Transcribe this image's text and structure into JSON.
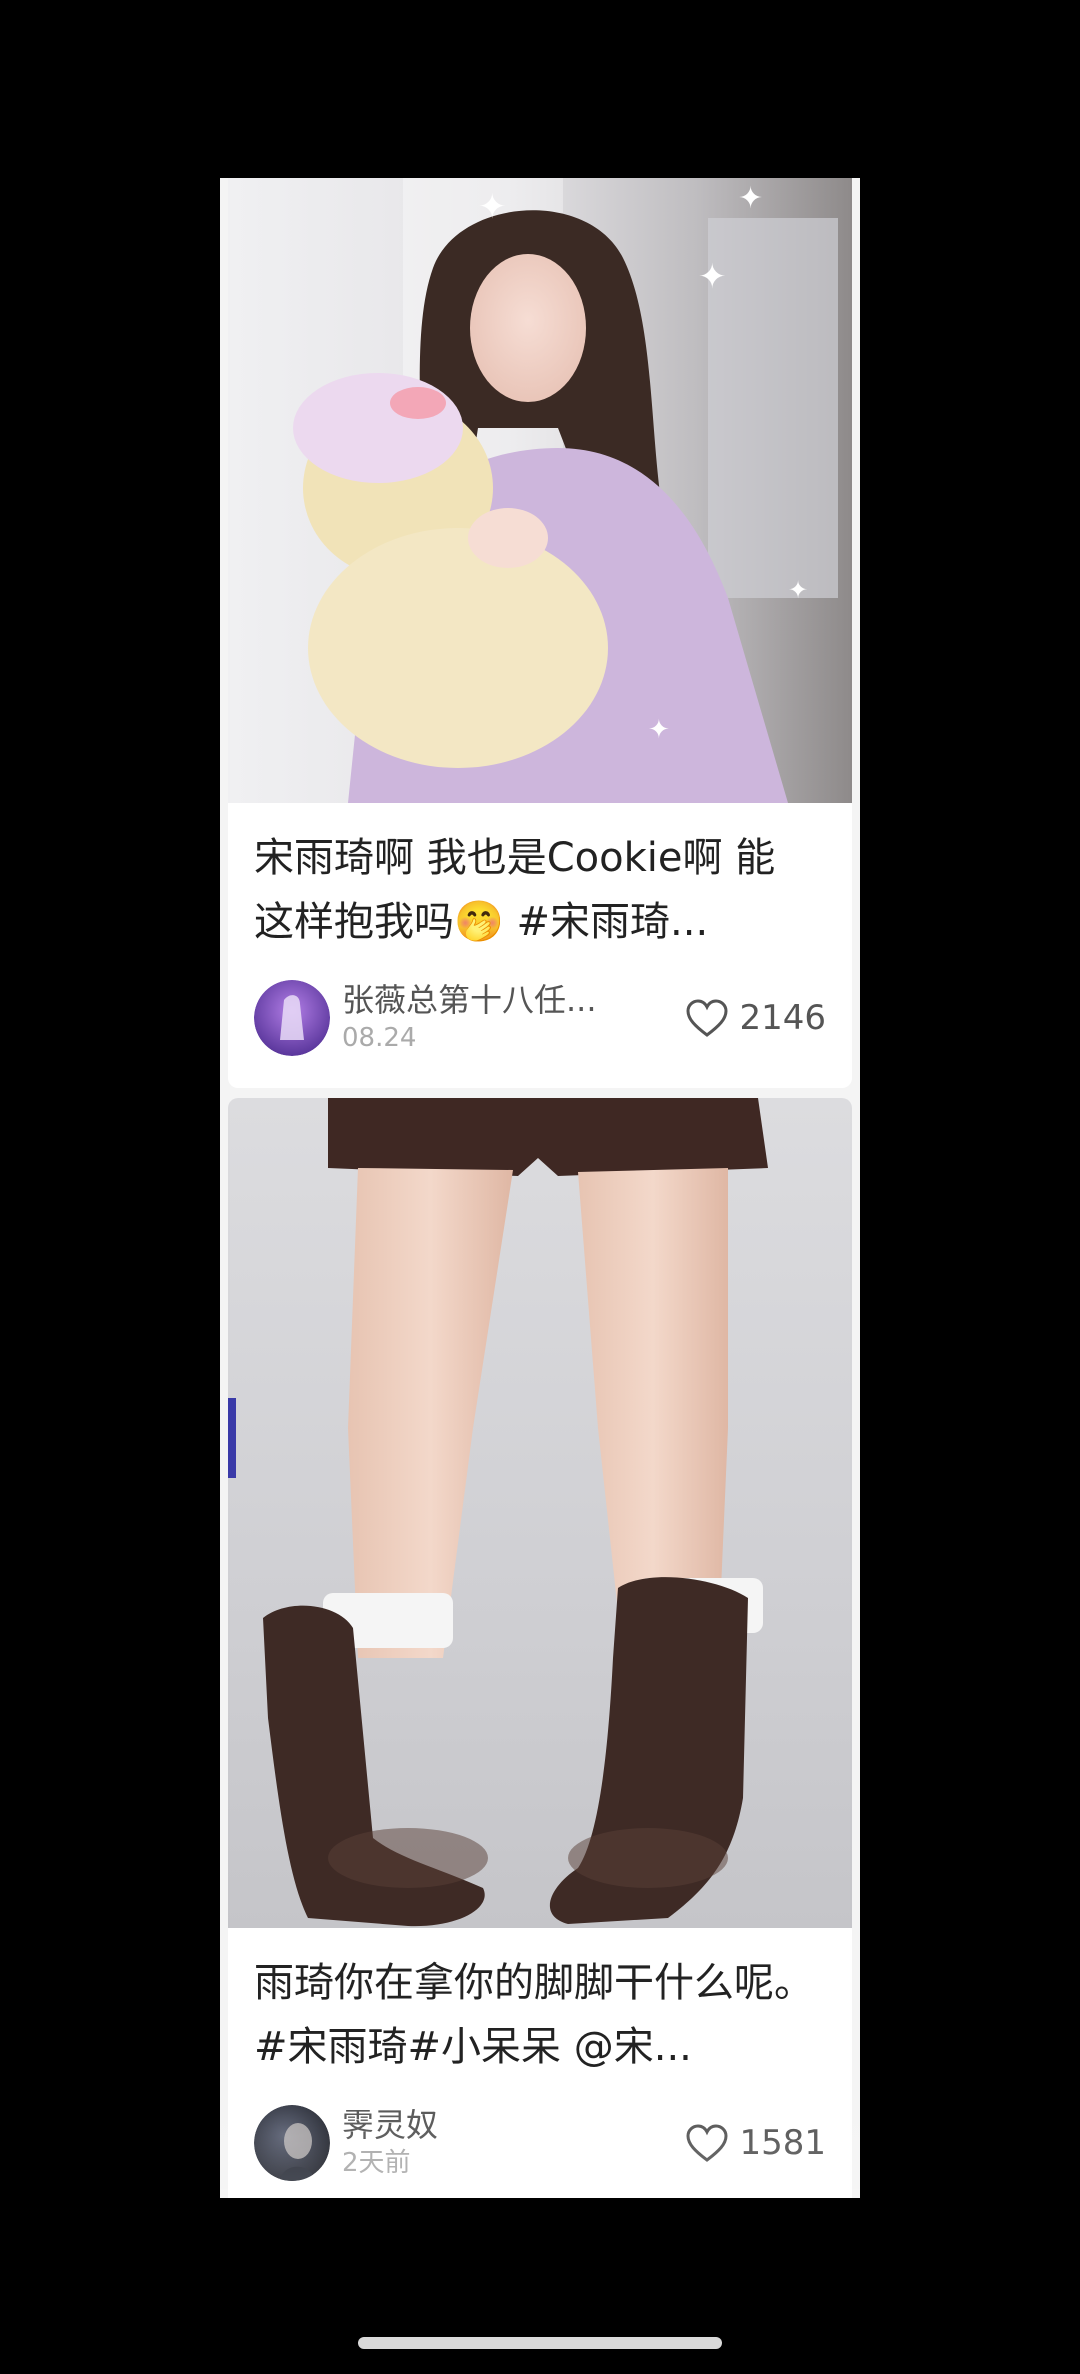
{
  "feed": {
    "posts": [
      {
        "title": "宋雨琦啊 我也是Cookie啊 能这样抱我吗🤭 #宋雨琦...",
        "author": "张薇总第十八任...",
        "date": "08.24",
        "likes": "2146",
        "cover_icon": "girl-hugging-plush-photo",
        "avatar_icon": "purple-stage-avatar"
      },
      {
        "title": "雨琦你在拿你的脚脚干什么呢。#宋雨琦#小呆呆 @宋...",
        "author": "霁灵奴",
        "date": "2天前",
        "likes": "1581",
        "cover_icon": "legs-brown-boots-photo",
        "avatar_icon": "dark-portrait-avatar"
      }
    ]
  },
  "colors": {
    "background": "#000000",
    "card": "#ffffff",
    "title_text": "#222222",
    "meta_text": "#555555",
    "date_text": "#aaaaaa"
  }
}
